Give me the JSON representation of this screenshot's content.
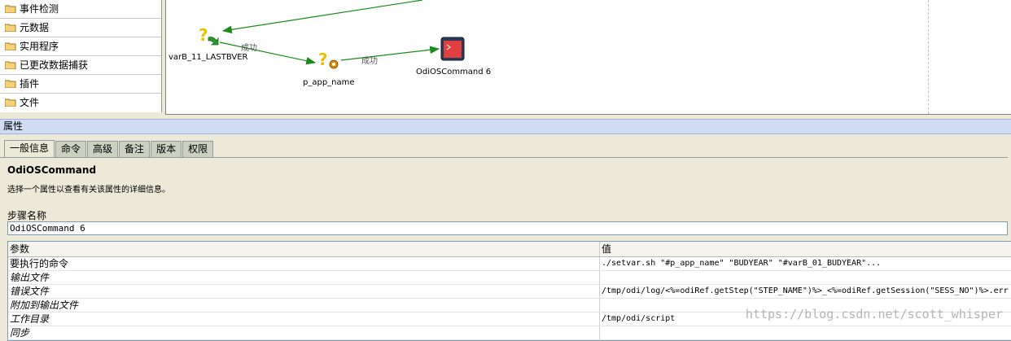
{
  "tree": {
    "items": [
      "事件检测",
      "元数据",
      "实用程序",
      "已更改数据捕获",
      "插件",
      "文件"
    ]
  },
  "diagram": {
    "nodes": [
      {
        "label": "varB_11_LASTBVER",
        "icon": "variable-refresh-icon"
      },
      {
        "label": "p_app_name",
        "icon": "variable-set-icon"
      },
      {
        "label": "OdiOSCommand 6",
        "icon": "os-command-icon"
      }
    ],
    "links": [
      {
        "label": "成功"
      },
      {
        "label": "成功"
      }
    ]
  },
  "properties": {
    "header": "属性",
    "tabs": [
      "一般信息",
      "命令",
      "高级",
      "备注",
      "版本",
      "权限"
    ],
    "active_tab": "一般信息",
    "title": "OdiOSCommand",
    "description": "选择一个属性以查看有关该属性的详细信息。",
    "step_name_label": "步骤名称",
    "step_name_value": "OdiOSCommand 6",
    "grid": {
      "headers": [
        "参数",
        "值"
      ],
      "rows": [
        {
          "param": "要执行的命令",
          "value": "./setvar.sh \"#p_app_name\" \"BUDYEAR\" \"#varB_01_BUDYEAR\"..."
        },
        {
          "param": "输出文件",
          "value": ""
        },
        {
          "param": "错误文件",
          "value": "/tmp/odi/log/<%=odiRef.getStep(\"STEP_NAME\")%>_<%=odiRef.getSession(\"SESS_NO\")%>.err"
        },
        {
          "param": "附加到输出文件",
          "value": ""
        },
        {
          "param": "工作目录",
          "value": "/tmp/odi/script"
        },
        {
          "param": "同步",
          "value": ""
        }
      ]
    }
  },
  "watermark": "https://blog.csdn.net/scott_whisper",
  "colors": {
    "link_arrow": "#1a8a1a",
    "header_bg": "#cfdcf3",
    "window_bg": "#ece9d8",
    "command_icon": "#e04040"
  }
}
